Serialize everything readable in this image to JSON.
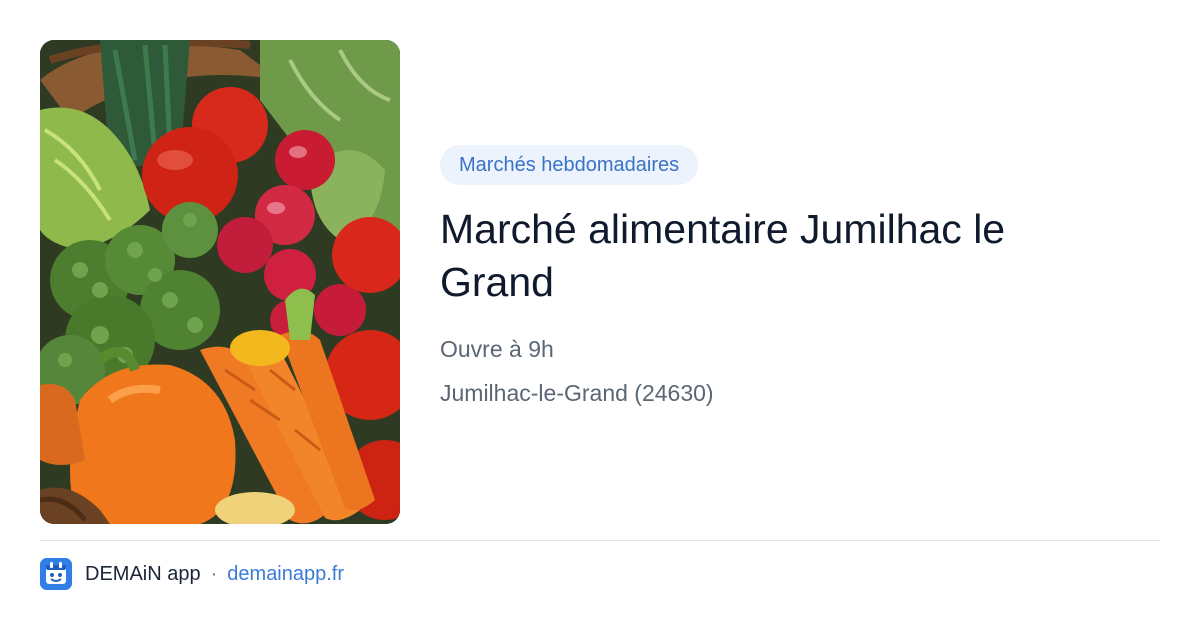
{
  "badge": "Marchés hebdomadaires",
  "title": "Marché alimentaire Jumilhac le Grand",
  "opening": "Ouvre à 9h",
  "location": "Jumilhac-le-Grand (24630)",
  "footer": {
    "app_name": "DEMAiN app",
    "separator": "·",
    "domain": "demainapp.fr"
  },
  "image": {
    "subject": "fresh vegetables: tomatoes, radishes, broccoli, carrots, bell pepper, lettuce in a basket"
  },
  "colors": {
    "badge_bg": "#edf3fc",
    "badge_text": "#3a72c7",
    "title": "#0f1a2d",
    "meta": "#5b6675",
    "link": "#3a7bd5",
    "app_icon": "#2f7fe6"
  }
}
